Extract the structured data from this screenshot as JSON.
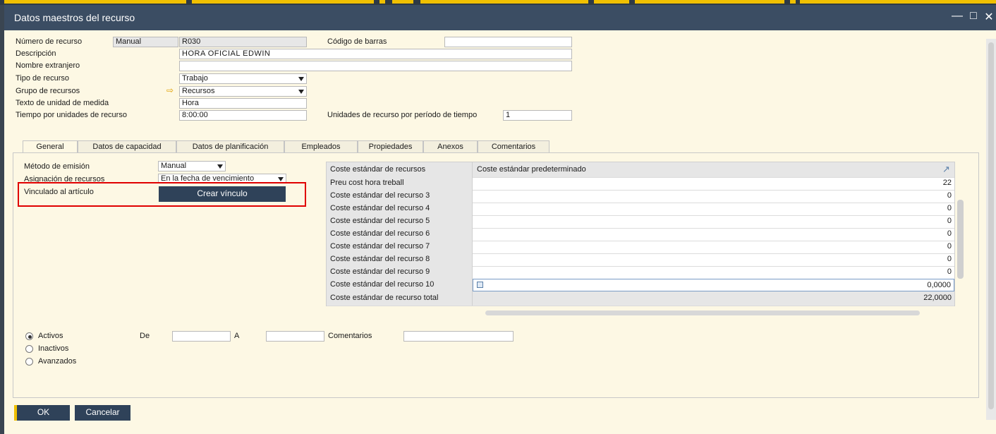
{
  "window": {
    "title": "Datos maestros del recurso"
  },
  "header": {
    "numero_label": "Número de recurso",
    "numero_series": "Manual",
    "numero_value": "R030",
    "codigo_barras_label": "Código de barras",
    "codigo_barras_value": "",
    "descripcion_label": "Descripción",
    "descripcion_value": "HORA OFICIAL EDWIN",
    "nombre_extranjero_label": "Nombre extranjero",
    "nombre_extranjero_value": "",
    "tipo_label": "Tipo de recurso",
    "tipo_value": "Trabajo",
    "grupo_label": "Grupo de recursos",
    "grupo_value": "Recursos",
    "texto_unidad_label": "Texto de unidad de medida",
    "texto_unidad_value": "Hora",
    "tiempo_label": "Tiempo por unidades de recurso",
    "tiempo_value": "8:00:00",
    "unidades_periodo_label": "Unidades de recurso por período de tiempo",
    "unidades_periodo_value": "1"
  },
  "tabs": [
    "General",
    "Datos de capacidad",
    "Datos de planificación",
    "Empleados",
    "Propiedades",
    "Anexos",
    "Comentarios"
  ],
  "general": {
    "metodo_label": "Método de emisión",
    "metodo_value": "Manual",
    "asignacion_label": "Asignación de recursos",
    "asignacion_value": "En la fecha de vencimiento",
    "vinculado_label": "Vinculado al artículo",
    "crear_vinculo_label": "Crear vínculo"
  },
  "cost_grid": {
    "header_left": "Coste estándar de recursos",
    "header_right": "Coste estándar predeterminado",
    "rows": [
      {
        "label": "Preu cost hora treball",
        "value": "22"
      },
      {
        "label": "Coste estándar del recurso 3",
        "value": "0"
      },
      {
        "label": "Coste estándar del recurso 4",
        "value": "0"
      },
      {
        "label": "Coste estándar del recurso 5",
        "value": "0"
      },
      {
        "label": "Coste estándar del recurso 6",
        "value": "0"
      },
      {
        "label": "Coste estándar del recurso 7",
        "value": "0"
      },
      {
        "label": "Coste estándar del recurso 8",
        "value": "0"
      },
      {
        "label": "Coste estándar del recurso 9",
        "value": "0"
      },
      {
        "label": "Coste estándar del recurso 10",
        "value": "0,0000"
      }
    ],
    "total_label": "Coste estándar de recurso total",
    "total_value": "22,0000"
  },
  "status": {
    "activos_label": "Activos",
    "inactivos_label": "Inactivos",
    "avanzados_label": "Avanzados",
    "selected": "Activos",
    "de_label": "De",
    "a_label": "A",
    "comentarios_label": "Comentarios"
  },
  "footer": {
    "ok_label": "OK",
    "cancel_label": "Cancelar"
  },
  "colors": {
    "titlebar": "#3b4d63",
    "background": "#fdf8e4",
    "button": "#2f4259",
    "highlight_box": "#e00000",
    "accent": "#f0c000"
  },
  "icons": [
    "minimize-icon",
    "maximize-icon",
    "close-icon",
    "dropdown-arrow-icon",
    "link-arrow-icon",
    "expand-icon",
    "calculator-icon",
    "radio-icon"
  ]
}
